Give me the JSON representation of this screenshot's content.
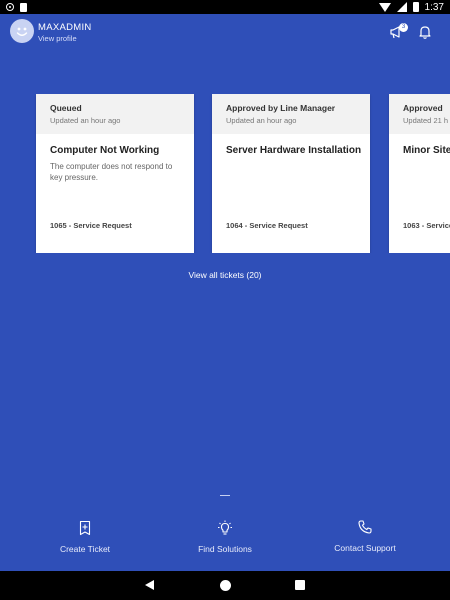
{
  "status_bar": {
    "time": "1:37"
  },
  "header": {
    "user_name": "MAXADMIN",
    "view_profile": "View profile",
    "notification_count": "3"
  },
  "tickets": [
    {
      "status": "Queued",
      "updated": "Updated an hour ago",
      "title": "Computer Not Working",
      "description": "The computer does not respond to key pressure.",
      "footer": "1065 - Service Request"
    },
    {
      "status": "Approved by Line Manager",
      "updated": "Updated an hour ago",
      "title": "Server Hardware Installation",
      "description": "",
      "footer": "1064 - Service Request"
    },
    {
      "status": "Approved",
      "updated": "Updated 21 h",
      "title": "Minor Site I",
      "description": "",
      "footer": "1063 - Service"
    }
  ],
  "view_all": "View all tickets (20)",
  "actions": {
    "create": "Create Ticket",
    "find": "Find Solutions",
    "contact": "Contact Support"
  },
  "colors": {
    "background": "#2f4fb8",
    "card": "#ffffff",
    "card_header": "#f2f2f2"
  }
}
